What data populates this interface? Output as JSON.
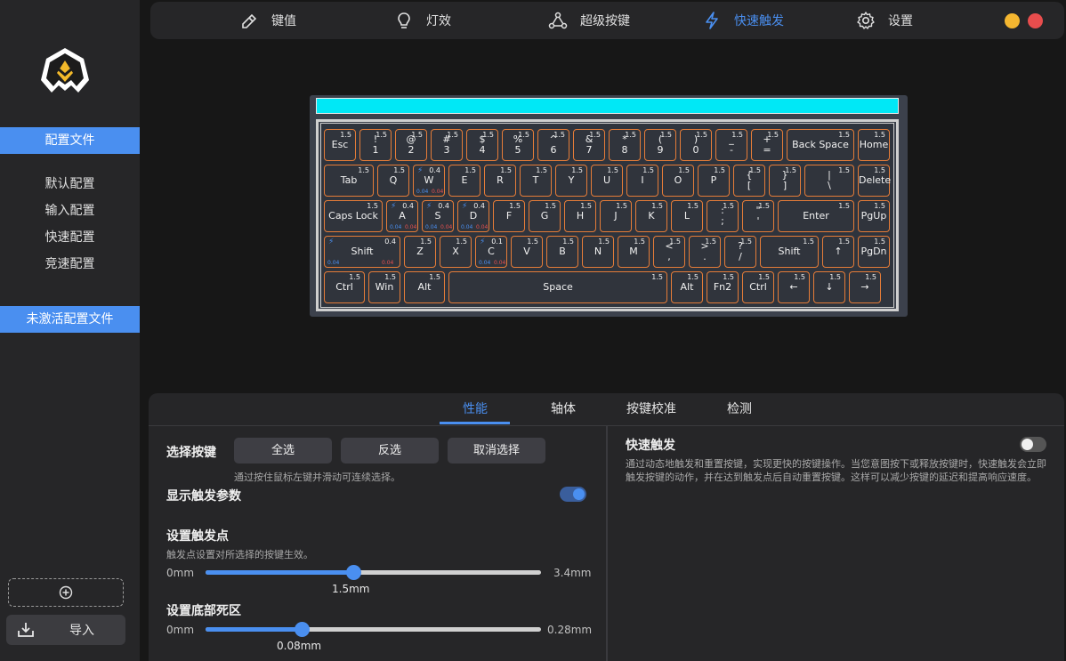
{
  "sidebar": {
    "profile_file": "配置文件",
    "items": [
      "默认配置",
      "输入配置",
      "快速配置",
      "竞速配置"
    ],
    "inactive_profile": "未激活配置文件",
    "add_icon": "plus-circle-icon",
    "import_label": "导入",
    "import_icon": "import-tray-icon"
  },
  "nav": {
    "items": [
      {
        "label": "键值",
        "icon": "key-pen-icon"
      },
      {
        "label": "灯效",
        "icon": "lightbulb-icon"
      },
      {
        "label": "超级按键",
        "icon": "nodes-icon"
      },
      {
        "label": "快速触发",
        "icon": "lightning-icon"
      },
      {
        "label": "设置",
        "icon": "gear-icon"
      }
    ],
    "active": "快速触发",
    "colors": {
      "minimize": "#f4b630",
      "close": "#e84d4d",
      "accent": "#4a8ff0"
    }
  },
  "keyboard": {
    "light_color": "#00e8f6",
    "key_border_color": "#e57c38",
    "rows": [
      [
        {
          "top": "1.5",
          "label": "Esc"
        },
        {
          "top": "1.5",
          "label": "!\n1"
        },
        {
          "top": "1.5",
          "label": "@\n2"
        },
        {
          "top": "1.5",
          "label": "#\n3"
        },
        {
          "top": "1.5",
          "label": "$\n4"
        },
        {
          "top": "1.5",
          "label": "%\n5"
        },
        {
          "top": "1.5",
          "label": "^\n6"
        },
        {
          "top": "1.5",
          "label": "&\n7"
        },
        {
          "top": "1.5",
          "label": "*\n8"
        },
        {
          "top": "1.5",
          "label": "(\n9"
        },
        {
          "top": "1.5",
          "label": ")\n0"
        },
        {
          "top": "1.5",
          "label": "_\n-"
        },
        {
          "top": "1.5",
          "label": "+\n="
        },
        {
          "top": "1.5",
          "label": "Back Space"
        },
        {
          "top": "1.5",
          "label": "Home"
        }
      ],
      [
        {
          "top": "1.5",
          "label": "Tab"
        },
        {
          "top": "1.5",
          "label": "Q"
        },
        {
          "top": "0.4",
          "label": "W",
          "rt": true,
          "b1": "0.04",
          "b2": "0.04"
        },
        {
          "top": "1.5",
          "label": "E"
        },
        {
          "top": "1.5",
          "label": "R"
        },
        {
          "top": "1.5",
          "label": "T"
        },
        {
          "top": "1.5",
          "label": "Y"
        },
        {
          "top": "1.5",
          "label": "U"
        },
        {
          "top": "1.5",
          "label": "I"
        },
        {
          "top": "1.5",
          "label": "O"
        },
        {
          "top": "1.5",
          "label": "P"
        },
        {
          "top": "1.5",
          "label": "{\n["
        },
        {
          "top": "1.5",
          "label": "}\n]"
        },
        {
          "top": "1.5",
          "label": "|\n\\"
        },
        {
          "top": "1.5",
          "label": "Delete"
        }
      ],
      [
        {
          "top": "1.5",
          "label": "Caps Lock"
        },
        {
          "top": "0.4",
          "label": "A",
          "rt": true,
          "b1": "0.04",
          "b2": "0.04"
        },
        {
          "top": "0.4",
          "label": "S",
          "rt": true,
          "b1": "0.04",
          "b2": "0.04"
        },
        {
          "top": "0.4",
          "label": "D",
          "rt": true,
          "b1": "0.04",
          "b2": "0.04"
        },
        {
          "top": "1.5",
          "label": "F"
        },
        {
          "top": "1.5",
          "label": "G"
        },
        {
          "top": "1.5",
          "label": "H"
        },
        {
          "top": "1.5",
          "label": "J"
        },
        {
          "top": "1.5",
          "label": "K"
        },
        {
          "top": "1.5",
          "label": "L"
        },
        {
          "top": "1.5",
          "label": ":\n;"
        },
        {
          "top": "1.5",
          "label": "\"\n'"
        },
        {
          "top": "1.5",
          "label": "Enter"
        },
        {
          "top": "1.5",
          "label": "PgUp"
        }
      ],
      [
        {
          "top": "0.4",
          "label": "Shift",
          "rt": true,
          "b1": "0.04",
          "b2": "0.04"
        },
        {
          "top": "1.5",
          "label": "Z"
        },
        {
          "top": "1.5",
          "label": "X"
        },
        {
          "top": "0.1",
          "label": "C",
          "rt": true,
          "b1": "0.04",
          "b2": "0.04"
        },
        {
          "top": "1.5",
          "label": "V"
        },
        {
          "top": "1.5",
          "label": "B"
        },
        {
          "top": "1.5",
          "label": "N"
        },
        {
          "top": "1.5",
          "label": "M"
        },
        {
          "top": "1.5",
          "label": "<\n,"
        },
        {
          "top": "1.5",
          "label": ">\n."
        },
        {
          "top": "1.5",
          "label": "?\n/"
        },
        {
          "top": "1.5",
          "label": "Shift"
        },
        {
          "top": "1.5",
          "label": "↑"
        },
        {
          "top": "1.5",
          "label": "PgDn"
        }
      ],
      [
        {
          "top": "1.5",
          "label": "Ctrl"
        },
        {
          "top": "1.5",
          "label": "Win"
        },
        {
          "top": "1.5",
          "label": "Alt"
        },
        {
          "top": "1.5",
          "label": "Space"
        },
        {
          "top": "1.5",
          "label": "Alt"
        },
        {
          "top": "1.5",
          "label": "Fn2"
        },
        {
          "top": "1.5",
          "label": "Ctrl"
        },
        {
          "top": "1.5",
          "label": "←"
        },
        {
          "top": "1.5",
          "label": "↓"
        },
        {
          "top": "1.5",
          "label": "→"
        }
      ]
    ]
  },
  "panel": {
    "tabs": [
      "性能",
      "轴体",
      "按键校准",
      "检测"
    ],
    "active_tab": "性能",
    "select_keys_label": "选择按键",
    "select_buttons": [
      "全选",
      "反选",
      "取消选择"
    ],
    "select_hint": "通过按住鼠标左键并滑动可连续选择。",
    "show_params_label": "显示触发参数",
    "show_params_on": true,
    "trigger_point": {
      "title": "设置触发点",
      "hint": "触发点设置对所选择的按键生效。",
      "min": "0mm",
      "max": "3.4mm",
      "value_label": "1.5mm",
      "fraction": 0.441
    },
    "deadzone": {
      "title": "设置底部死区",
      "min": "0mm",
      "max": "0.28mm",
      "value_label": "0.08mm",
      "fraction": 0.286
    },
    "rapid_trigger": {
      "title": "快速触发",
      "enabled": false,
      "description": "通过动态地触发和重置按键，实现更快的按键操作。当您意图按下或释放按键时，快速触发会立即触发按键的动作，并在达到触发点后自动重置按键。这样可以减少按键的延迟和提高响应速度。"
    }
  }
}
